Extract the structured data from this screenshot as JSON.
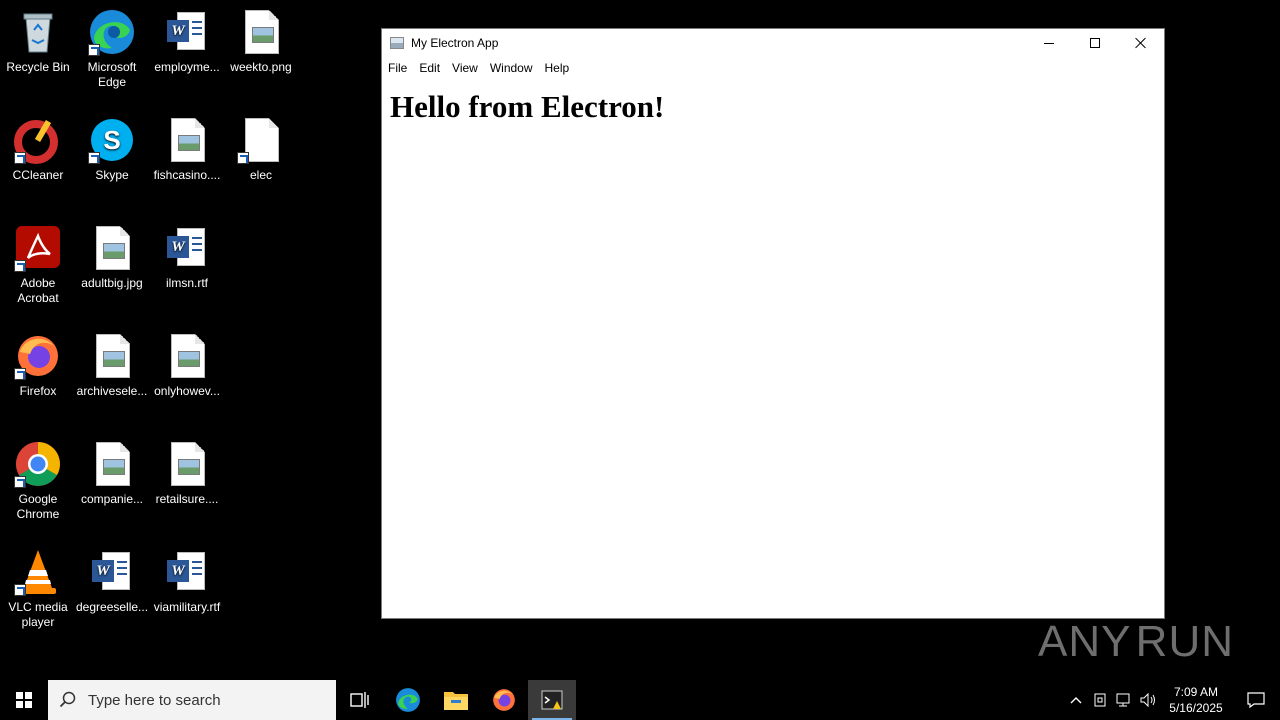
{
  "desktop": {
    "icons": [
      {
        "label": "Recycle Bin",
        "icon": "recycle-bin-icon"
      },
      {
        "label": "Microsoft Edge",
        "icon": "edge-icon"
      },
      {
        "label": "employme...",
        "icon": "word-doc-icon"
      },
      {
        "label": "weekto.png",
        "icon": "image-file-icon"
      },
      {
        "label": "CCleaner",
        "icon": "ccleaner-icon"
      },
      {
        "label": "Skype",
        "icon": "skype-icon"
      },
      {
        "label": "fishcasino....",
        "icon": "image-file-icon"
      },
      {
        "label": "elec",
        "icon": "blank-file-icon"
      },
      {
        "label": "Adobe Acrobat",
        "icon": "acrobat-icon"
      },
      {
        "label": "adultbig.jpg",
        "icon": "image-file-icon"
      },
      {
        "label": "ilmsn.rtf",
        "icon": "word-doc-icon"
      },
      {
        "label": "Firefox",
        "icon": "firefox-icon"
      },
      {
        "label": "archivesele...",
        "icon": "image-file-icon"
      },
      {
        "label": "onlyhowev...",
        "icon": "image-file-icon"
      },
      {
        "label": "Google Chrome",
        "icon": "chrome-icon"
      },
      {
        "label": "companie...",
        "icon": "image-file-icon"
      },
      {
        "label": "retailsure....",
        "icon": "image-file-icon"
      },
      {
        "label": "VLC media player",
        "icon": "vlc-icon"
      },
      {
        "label": "degreeselle...",
        "icon": "word-doc-icon"
      },
      {
        "label": "viamilitary.rtf",
        "icon": "word-doc-icon"
      }
    ]
  },
  "window": {
    "title": "My Electron App",
    "menu": [
      "File",
      "Edit",
      "View",
      "Window",
      "Help"
    ],
    "heading": "Hello from Electron!"
  },
  "watermark": {
    "left": "ANY",
    "right": "RUN"
  },
  "taskbar": {
    "search_placeholder": "Type here to search",
    "time": "7:09 AM",
    "date": "5/16/2025"
  }
}
